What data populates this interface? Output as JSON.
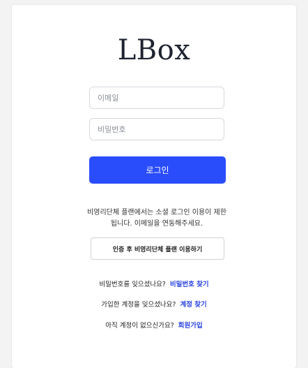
{
  "brand": {
    "logo_text": "LBox"
  },
  "login_form": {
    "email_placeholder": "이메일",
    "password_placeholder": "비밀번호",
    "login_label": "로그인"
  },
  "org_notice": {
    "text": "비영리단체 플랜에서는 소셜 로그인 이용이 제한됩니다. 이메일을 연동해주세요.",
    "verify_button_label": "인증 후 비영리단체 플랜 이용하기"
  },
  "help_links": {
    "forgot_password": {
      "prompt": "비밀번호를 잊으셨나요?",
      "link": "비밀번호 찾기"
    },
    "forgot_account": {
      "prompt": "가입한 계정을 잊으셨나요?",
      "link": "계정 찾기"
    },
    "signup": {
      "prompt": "아직 계정이 없으신가요?",
      "link": "회원가입"
    }
  },
  "colors": {
    "primary": "#2a4dfb",
    "link": "#2a44e0",
    "page_background": "#f3f3f3",
    "card_background": "#ffffff"
  }
}
